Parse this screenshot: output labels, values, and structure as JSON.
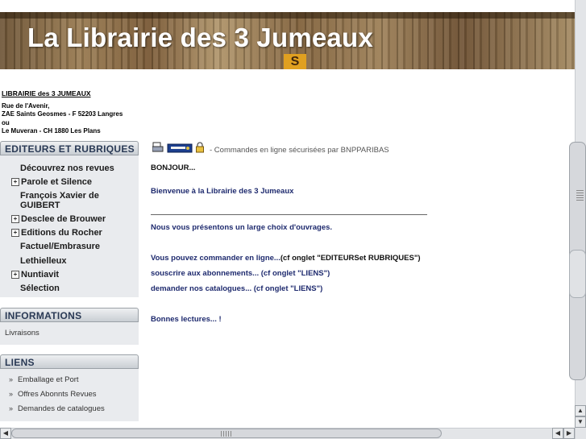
{
  "banner": {
    "title": "La Librairie des 3 Jumeaux",
    "tag": "S"
  },
  "shop": {
    "name": "LIBRAIRIE des 3 JUMEAUX",
    "lines": [
      "Rue de l'Avenir,",
      "ZAE Saints Geosmes - F 52203 Langres",
      "ou",
      "Le Muveran - CH 1880 Les Plans"
    ]
  },
  "sidebar": {
    "editeurs": {
      "title": "EDITEURS ET RUBRIQUES",
      "items": [
        {
          "label": "Découvrez nos revues",
          "expandable": false
        },
        {
          "label": "Parole et Silence",
          "expandable": true
        },
        {
          "label": "François Xavier de",
          "expandable": false
        },
        {
          "label": "GUIBERT",
          "expandable": false
        },
        {
          "label": "Desclee de Brouwer",
          "expandable": true
        },
        {
          "label": "Editions du Rocher",
          "expandable": true
        },
        {
          "label": "Factuel/Embrasure",
          "expandable": false
        },
        {
          "label": "Lethielleux",
          "expandable": false
        },
        {
          "label": "Nuntiavit",
          "expandable": true
        },
        {
          "label": "Sélection",
          "expandable": false
        }
      ]
    },
    "informations": {
      "title": "INFORMATIONS",
      "items": [
        "Livraisons"
      ]
    },
    "liens": {
      "title": "LIENS",
      "items": [
        "Emballage et Port",
        "Offres Abonnts Revues",
        "Demandes de catalogues"
      ]
    }
  },
  "main": {
    "secure_text": "- Commandes en ligne sécurisées par BNPPARIBAS",
    "greeting": "BONJOUR...",
    "welcome": "Bienvenue à la Librairie des 3 Jumeaux",
    "choice": "Nous vous présentons un large choix d'ouvrages.",
    "order_line": "Vous pouvez commander en ligne...",
    "order_ref": "(cf onglet \"EDITEURSet RUBRIQUES\")",
    "subscribe": "souscrire aux abonnements... (cf onglet \"LIENS\")",
    "catalogues": "demander nos catalogues... (cf onglet \"LIENS\")",
    "closing": "Bonnes lectures... !"
  },
  "colors": {
    "accent_text": "#1e2a6e",
    "panel_header_text": "#2a3a55"
  },
  "icons": [
    "printer-icon",
    "card-icon",
    "padlock-icon",
    "chevron-double-right-icon"
  ]
}
